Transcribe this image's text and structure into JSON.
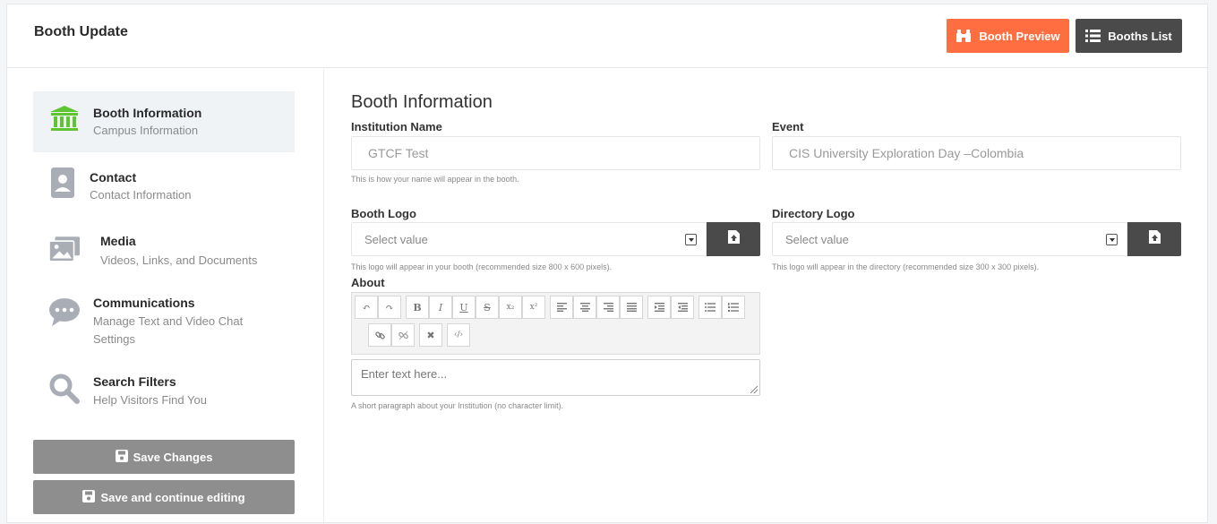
{
  "header": {
    "title": "Booth Update",
    "preview_label": "Booth Preview",
    "list_label": "Booths List"
  },
  "sidebar": {
    "items": [
      {
        "title": "Booth Information",
        "subtitle": "Campus Information",
        "icon": "institution-icon"
      },
      {
        "title": "Contact",
        "subtitle": "Contact Information",
        "icon": "contact-card-icon"
      },
      {
        "title": "Media",
        "subtitle": "Videos, Links, and Documents",
        "icon": "media-icon"
      },
      {
        "title": "Communications",
        "subtitle_line1": "Manage Text and Video Chat",
        "subtitle_line2": "Settings",
        "icon": "chat-icon"
      },
      {
        "title": "Search Filters",
        "subtitle": "Help Visitors Find You",
        "icon": "search-icon"
      }
    ],
    "save_label": "Save Changes",
    "save_continue_label": "Save and continue editing"
  },
  "main": {
    "section_title": "Booth Information",
    "institution": {
      "label": "Institution Name",
      "value": "GTCF Test",
      "help": "This is how your name will appear in the booth."
    },
    "event": {
      "label": "Event",
      "value": "CIS University Exploration Day –Colombia"
    },
    "booth_logo": {
      "label": "Booth Logo",
      "placeholder": "Select value",
      "help": "This logo will appear in your booth (recommended size 800 x 600 pixels)."
    },
    "directory_logo": {
      "label": "Directory Logo",
      "placeholder": "Select value",
      "help": "This logo will appear in the directory (recommended size 300 x 300 pixels)."
    },
    "about": {
      "label": "About",
      "placeholder": "Enter text here...",
      "help": "A short paragraph about your Institution (no character limit)."
    },
    "toolbar": {
      "undo": "↶",
      "redo": "↷",
      "bold": "B",
      "italic": "I",
      "underline": "U",
      "strike": "S",
      "subscript": "x₂",
      "superscript": "x²",
      "clear": "✖",
      "code": "‹/›"
    }
  },
  "colors": {
    "accent": "#ff6e40",
    "dark_button": "#4a4a4a",
    "active_icon": "#5cc531",
    "muted_icon": "#a9adb5",
    "save_button": "#8e8e8e"
  }
}
